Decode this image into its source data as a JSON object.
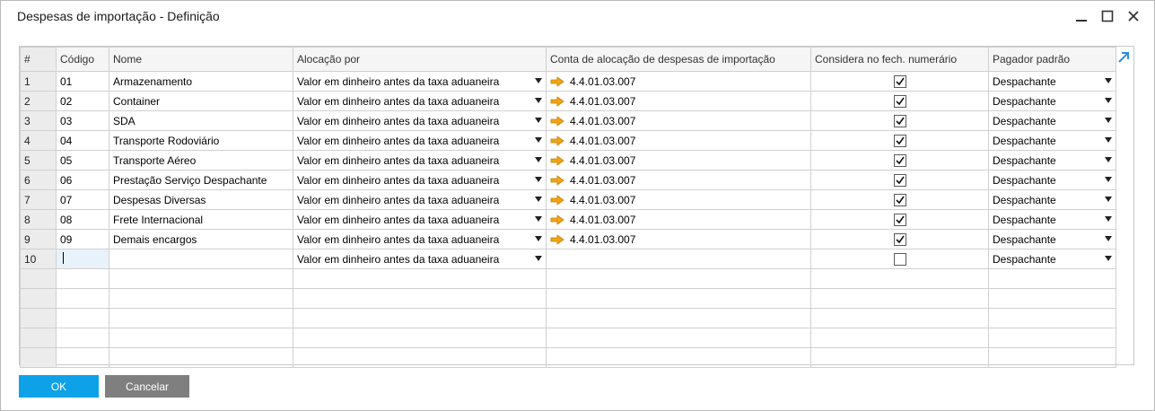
{
  "window": {
    "title": "Despesas de importação - Definição"
  },
  "grid": {
    "columns": [
      "#",
      "Código",
      "Nome",
      "Alocação por",
      "Conta de alocação de despesas de importação",
      "Considera no fech. numerário",
      "Pagador padrão"
    ],
    "rows": [
      {
        "num": "1",
        "codigo": "01",
        "nome": "Armazenamento",
        "alocacao": "Valor em dinheiro antes da taxa aduaneira",
        "conta": "4.4.01.03.007",
        "considera": true,
        "pagador": "Despachante"
      },
      {
        "num": "2",
        "codigo": "02",
        "nome": "Container",
        "alocacao": "Valor em dinheiro antes da taxa aduaneira",
        "conta": "4.4.01.03.007",
        "considera": true,
        "pagador": "Despachante"
      },
      {
        "num": "3",
        "codigo": "03",
        "nome": "SDA",
        "alocacao": "Valor em dinheiro antes da taxa aduaneira",
        "conta": "4.4.01.03.007",
        "considera": true,
        "pagador": "Despachante"
      },
      {
        "num": "4",
        "codigo": "04",
        "nome": "Transporte Rodoviário",
        "alocacao": "Valor em dinheiro antes da taxa aduaneira",
        "conta": "4.4.01.03.007",
        "considera": true,
        "pagador": "Despachante"
      },
      {
        "num": "5",
        "codigo": "05",
        "nome": "Transporte Aéreo",
        "alocacao": "Valor em dinheiro antes da taxa aduaneira",
        "conta": "4.4.01.03.007",
        "considera": true,
        "pagador": "Despachante"
      },
      {
        "num": "6",
        "codigo": "06",
        "nome": "Prestação Serviço Despachante",
        "alocacao": "Valor em dinheiro antes da taxa aduaneira",
        "conta": "4.4.01.03.007",
        "considera": true,
        "pagador": "Despachante"
      },
      {
        "num": "7",
        "codigo": "07",
        "nome": "Despesas Diversas",
        "alocacao": "Valor em dinheiro antes da taxa aduaneira",
        "conta": "4.4.01.03.007",
        "considera": true,
        "pagador": "Despachante"
      },
      {
        "num": "8",
        "codigo": "08",
        "nome": "Frete Internacional",
        "alocacao": "Valor em dinheiro antes da taxa aduaneira",
        "conta": "4.4.01.03.007",
        "considera": true,
        "pagador": "Despachante"
      },
      {
        "num": "9",
        "codigo": "09",
        "nome": "Demais encargos",
        "alocacao": "Valor em dinheiro antes da taxa aduaneira",
        "conta": "4.4.01.03.007",
        "considera": true,
        "pagador": "Despachante"
      },
      {
        "num": "10",
        "codigo": "",
        "nome": "",
        "alocacao": "Valor em dinheiro antes da taxa aduaneira",
        "conta": "",
        "considera": false,
        "pagador": "Despachante"
      }
    ],
    "empty_rows": 5
  },
  "buttons": {
    "ok": "OK",
    "cancel": "Cancelar"
  },
  "icons": {
    "minimize": "minimize-icon",
    "maximize": "maximize-icon",
    "close": "close-icon",
    "expand": "expand-arrow-icon",
    "link_arrow": "link-arrow-icon",
    "dropdown": "dropdown-arrow-icon",
    "checkbox": "checkbox-icon"
  },
  "colors": {
    "ok_button": "#0da1e8",
    "cancel_button": "#7f7f7f",
    "link_arrow": "#f2a413",
    "expand_icon": "#2f8fd8"
  }
}
